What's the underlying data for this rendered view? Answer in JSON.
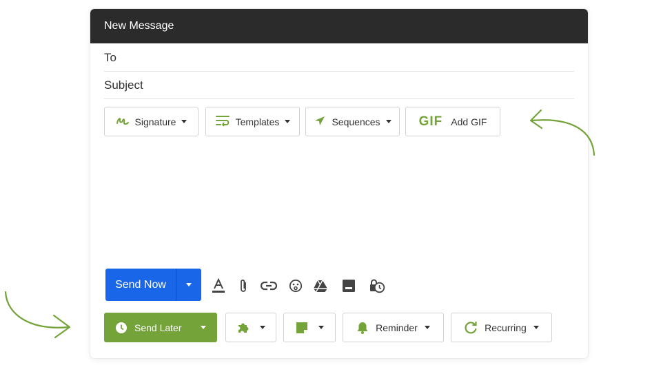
{
  "window": {
    "title": "New Message"
  },
  "fields": {
    "to_label": "To",
    "subject_label": "Subject"
  },
  "toolbar": {
    "signature_label": "Signature",
    "templates_label": "Templates",
    "sequences_label": "Sequences",
    "gif_badge": "GIF",
    "add_gif_label": "Add GIF"
  },
  "footer": {
    "send_now_label": "Send Now",
    "send_later_label": "Send Later",
    "reminder_label": "Reminder",
    "recurring_label": "Recurring"
  },
  "colors": {
    "accent_green": "#74a33a",
    "send_blue": "#1a66e8",
    "titlebar": "#2b2b2b"
  },
  "icons": [
    "signature-icon",
    "templates-icon",
    "sequences-icon",
    "gif-icon",
    "format-text-icon",
    "attach-icon",
    "link-icon",
    "emoji-icon",
    "drive-icon",
    "photo-icon",
    "confidential-icon",
    "clock-icon",
    "puzzle-icon",
    "note-icon",
    "bell-icon",
    "recurring-icon"
  ]
}
